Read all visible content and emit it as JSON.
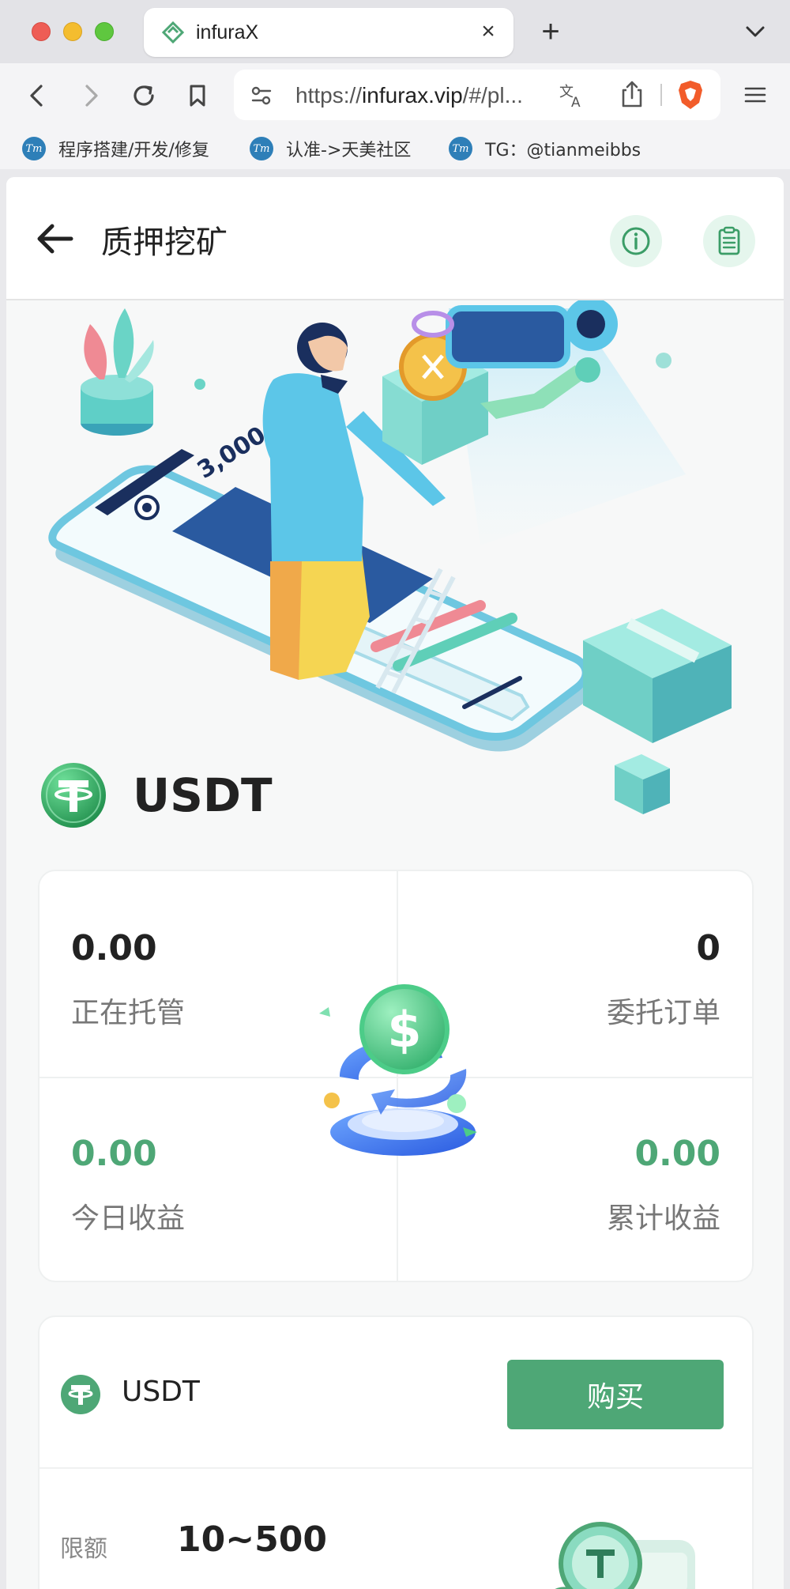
{
  "browser": {
    "tab_title": "infuraX",
    "url_scheme": "https://",
    "url_host": "infurax.vip",
    "url_rest": "/#/pl...",
    "bookmarks": [
      {
        "icon_text": "Tm",
        "label": "程序搭建/开发/修复"
      },
      {
        "icon_text": "Tm",
        "label": "认准->天美社区"
      },
      {
        "icon_text": "Tm",
        "label": "TG：@tianmeibbs"
      }
    ]
  },
  "header": {
    "title": "质押挖矿"
  },
  "coin": {
    "symbol": "USDT"
  },
  "stats": {
    "hosting_value": "0.00",
    "hosting_label": "正在托管",
    "orders_value": "0",
    "orders_label": "委托订单",
    "today_value": "0.00",
    "today_label": "今日收益",
    "total_value": "0.00",
    "total_label": "累计收益"
  },
  "product": {
    "name": "USDT",
    "buy_label": "购买",
    "limit_label": "限额",
    "limit_value": "10~500"
  },
  "colors": {
    "accent": "#4ea776",
    "accent_light": "#e5f6ed",
    "text": "#222222",
    "muted": "#777777"
  }
}
